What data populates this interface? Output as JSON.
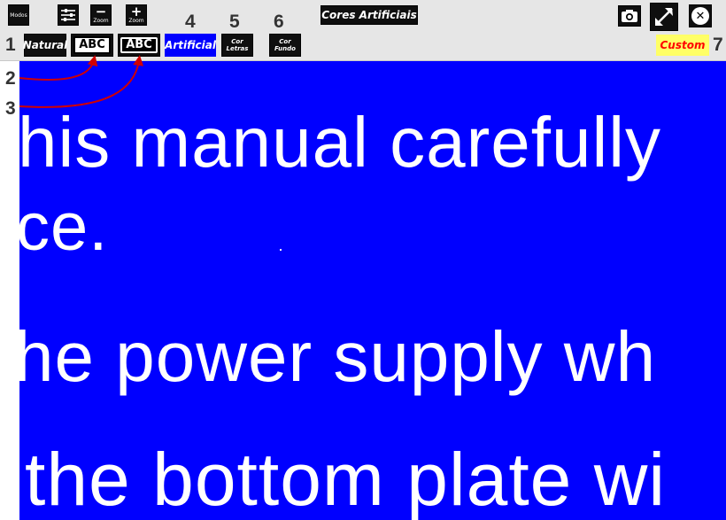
{
  "toolbar": {
    "modos_label": "Modos",
    "minus_label": "−",
    "plus_label": "+",
    "zoom_label": "Zoom",
    "mode_title": "Cores Artificiais",
    "natural_label": "Natural",
    "abc_label": "ABC",
    "artificial_label": "Artificial",
    "cor_label": "Cor",
    "letras_label": "Letras",
    "fundo_label": "Fundo",
    "custom_label": "Custom",
    "close_glyph": "✕"
  },
  "callouts": [
    "1",
    "2",
    "3",
    "4",
    "5",
    "6",
    "7"
  ],
  "document": {
    "lines": [
      "his manual carefully",
      "ce.",
      "he power supply wh",
      "the bottom plate wi"
    ]
  },
  "colors": {
    "background": "#0000ff",
    "text": "#ffffff",
    "custom": "#ffff66",
    "custom_text": "#ff0000",
    "artificial": "#0000ff"
  }
}
